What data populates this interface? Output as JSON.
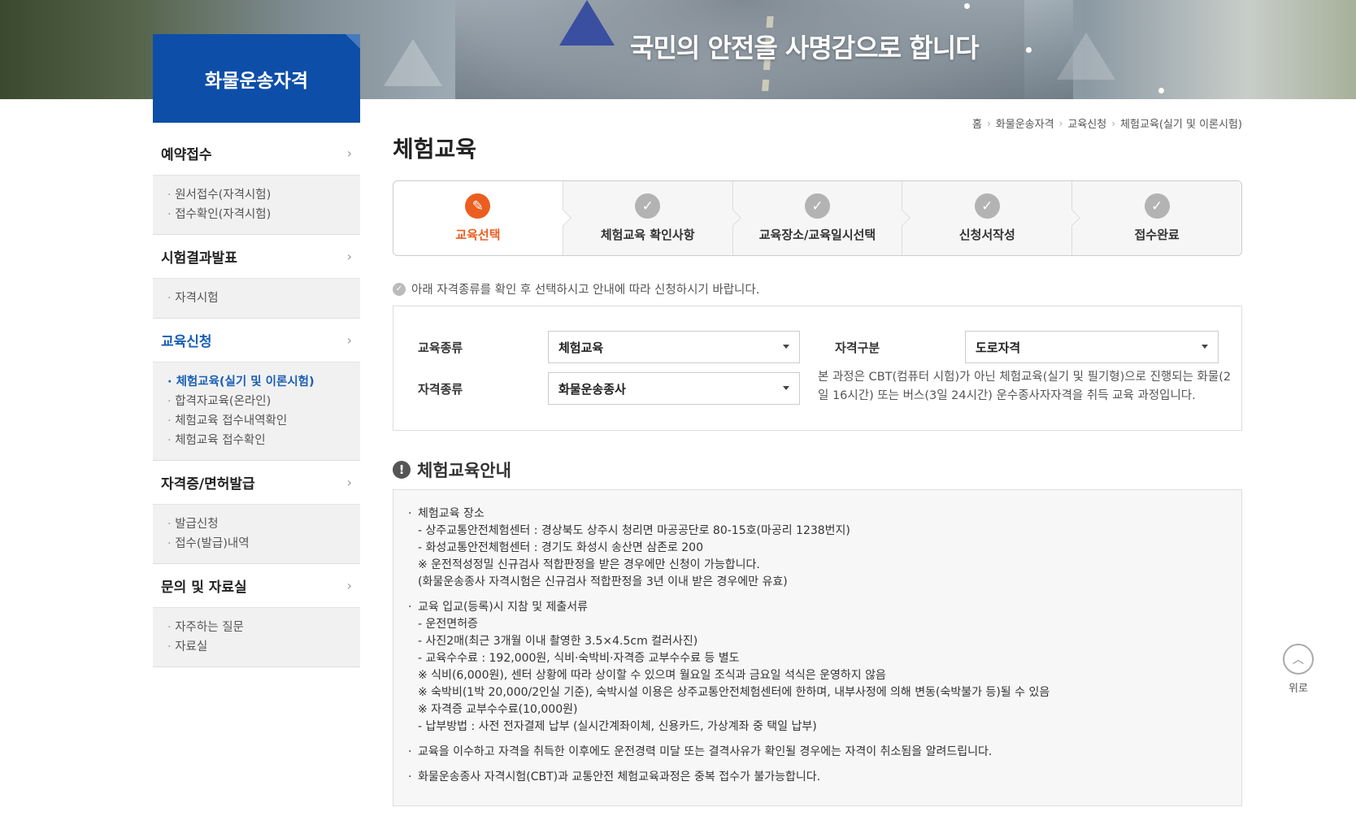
{
  "banner": {
    "slogan": "국민의 안전을 사명감으로 합니다"
  },
  "sidebar": {
    "title": "화물운송자격",
    "groups": [
      {
        "label": "예약접수",
        "active": false,
        "items": [
          "원서접수(자격시험)",
          "접수확인(자격시험)"
        ]
      },
      {
        "label": "시험결과발표",
        "active": false,
        "items": [
          "자격시험"
        ]
      },
      {
        "label": "교육신청",
        "active": true,
        "items": [
          "체험교육(실기 및 이론시험)",
          "합격자교육(온라인)",
          "체험교육 접수내역확인",
          "체험교육 접수확인"
        ]
      },
      {
        "label": "자격증/면허발급",
        "active": false,
        "items": [
          "발급신청",
          "접수(발급)내역"
        ]
      },
      {
        "label": "문의 및 자료실",
        "active": false,
        "items": [
          "자주하는 질문",
          "자료실"
        ]
      }
    ]
  },
  "breadcrumb": [
    "홈",
    "화물운송자격",
    "교육신청",
    "체험교육(실기 및 이론시험)"
  ],
  "page_title": "체험교육",
  "steps": [
    {
      "label": "교육선택",
      "icon": "pencil-icon",
      "current": true
    },
    {
      "label": "체험교육 확인사항",
      "icon": "check-icon",
      "current": false
    },
    {
      "label": "교육장소/교육일시선택",
      "icon": "check-icon",
      "current": false
    },
    {
      "label": "신청서작성",
      "icon": "check-icon",
      "current": false
    },
    {
      "label": "접수완료",
      "icon": "check-icon",
      "current": false
    }
  ],
  "notice": "아래 자격종류를 확인 후 선택하시고 안내에 따라 신청하시기 바랍니다.",
  "form": {
    "edu_type_label": "교육종류",
    "edu_type_value": "체험교육",
    "qual_div_label": "자격구분",
    "qual_div_value": "도로자격",
    "qual_type_label": "자격종류",
    "qual_type_value": "화물운송종사",
    "description": "본 과정은 CBT(컴퓨터 시험)가 아닌 체험교육(실기 및 필기형)으로 진행되는 화물(2일 16시간) 또는 버스(3일 24시간) 운수종사자자격을 취득 교육 과정입니다."
  },
  "info": {
    "title": "체험교육안내",
    "sections": [
      {
        "head": "체험교육 장소",
        "lines": [
          "- 상주교통안전체험센터 : 경상북도 상주시 청리면 마공공단로 80-15호(마공리 1238번지)",
          "- 화성교통안전체험센터 : 경기도 화성시 송산면 삼존로 200",
          "※ 운전적성정밀 신규검사 적합판정을 받은 경우에만 신청이 가능합니다.",
          "(화물운송종사 자격시험은 신규검사 적합판정을 3년 이내 받은 경우에만 유효)"
        ]
      },
      {
        "head": "교육 입교(등록)시 지참 및 제출서류",
        "lines": [
          "- 운전면허증",
          "- 사진2매(최근 3개월 이내 촬영한 3.5×4.5cm 컬러사진)",
          "- 교육수수료 : 192,000원, 식비·숙박비·자격증 교부수수료 등 별도",
          "※ 식비(6,000원), 센터 상황에 따라 상이할 수 있으며 월요일 조식과 금요일 석식은 운영하지 않음",
          "※ 숙박비(1박 20,000/2인실 기준), 숙박시설 이용은 상주교통안전체험센터에 한하며, 내부사정에 의해 변동(숙박불가 등)될 수 있음",
          "※ 자격증 교부수수료(10,000원)",
          "- 납부방법 : 사전 전자결제 납부 (실시간계좌이체, 신용카드, 가상계좌 중 택일 납부)"
        ]
      },
      {
        "head": "교육을 이수하고 자격을 취득한 이후에도 운전경력 미달 또는 결격사유가 확인될 경우에는 자격이 취소됨을 알려드립니다.",
        "lines": []
      },
      {
        "head": "화물운송종사 자격시험(CBT)과 교통안전 체험교육과정은 중복 접수가 불가능합니다.",
        "lines": []
      }
    ]
  },
  "top_button": {
    "label": "위로"
  },
  "colors": {
    "brand_blue": "#0d4ea8",
    "active_orange": "#ec5d20",
    "link_blue": "#1a5fb4"
  }
}
